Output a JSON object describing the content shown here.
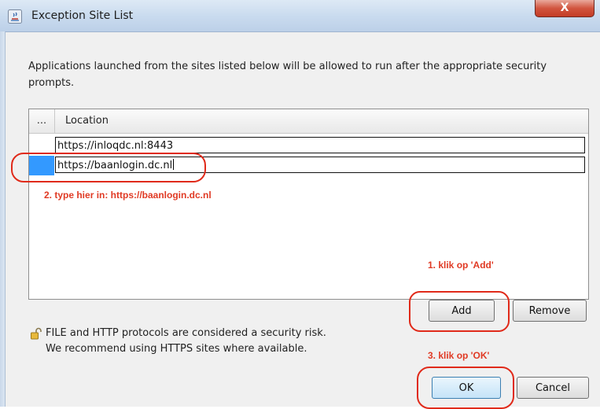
{
  "window": {
    "title": "Exception Site List",
    "close_label": "X"
  },
  "description": "Applications launched from the sites listed below will be allowed to run after the appropriate security prompts.",
  "table": {
    "columns": [
      "...",
      "Location"
    ],
    "rows": [
      {
        "location": "https://inloqdc.nl:8443"
      },
      {
        "location": "https://baanlogin.dc.nl"
      }
    ]
  },
  "annotations": {
    "step2": "2. type hier in: https://baanlogin.dc.nl",
    "step1": "1. klik op 'Add'",
    "step3": "3. klik op 'OK'"
  },
  "buttons": {
    "add": "Add",
    "remove": "Remove",
    "ok": "OK",
    "cancel": "Cancel"
  },
  "security_note": {
    "line1": "FILE and HTTP protocols are considered a security risk.",
    "line2": "We recommend using HTTPS sites where available."
  },
  "colors": {
    "annotation_red": "#e03a24",
    "selection_blue": "#3399ff"
  }
}
